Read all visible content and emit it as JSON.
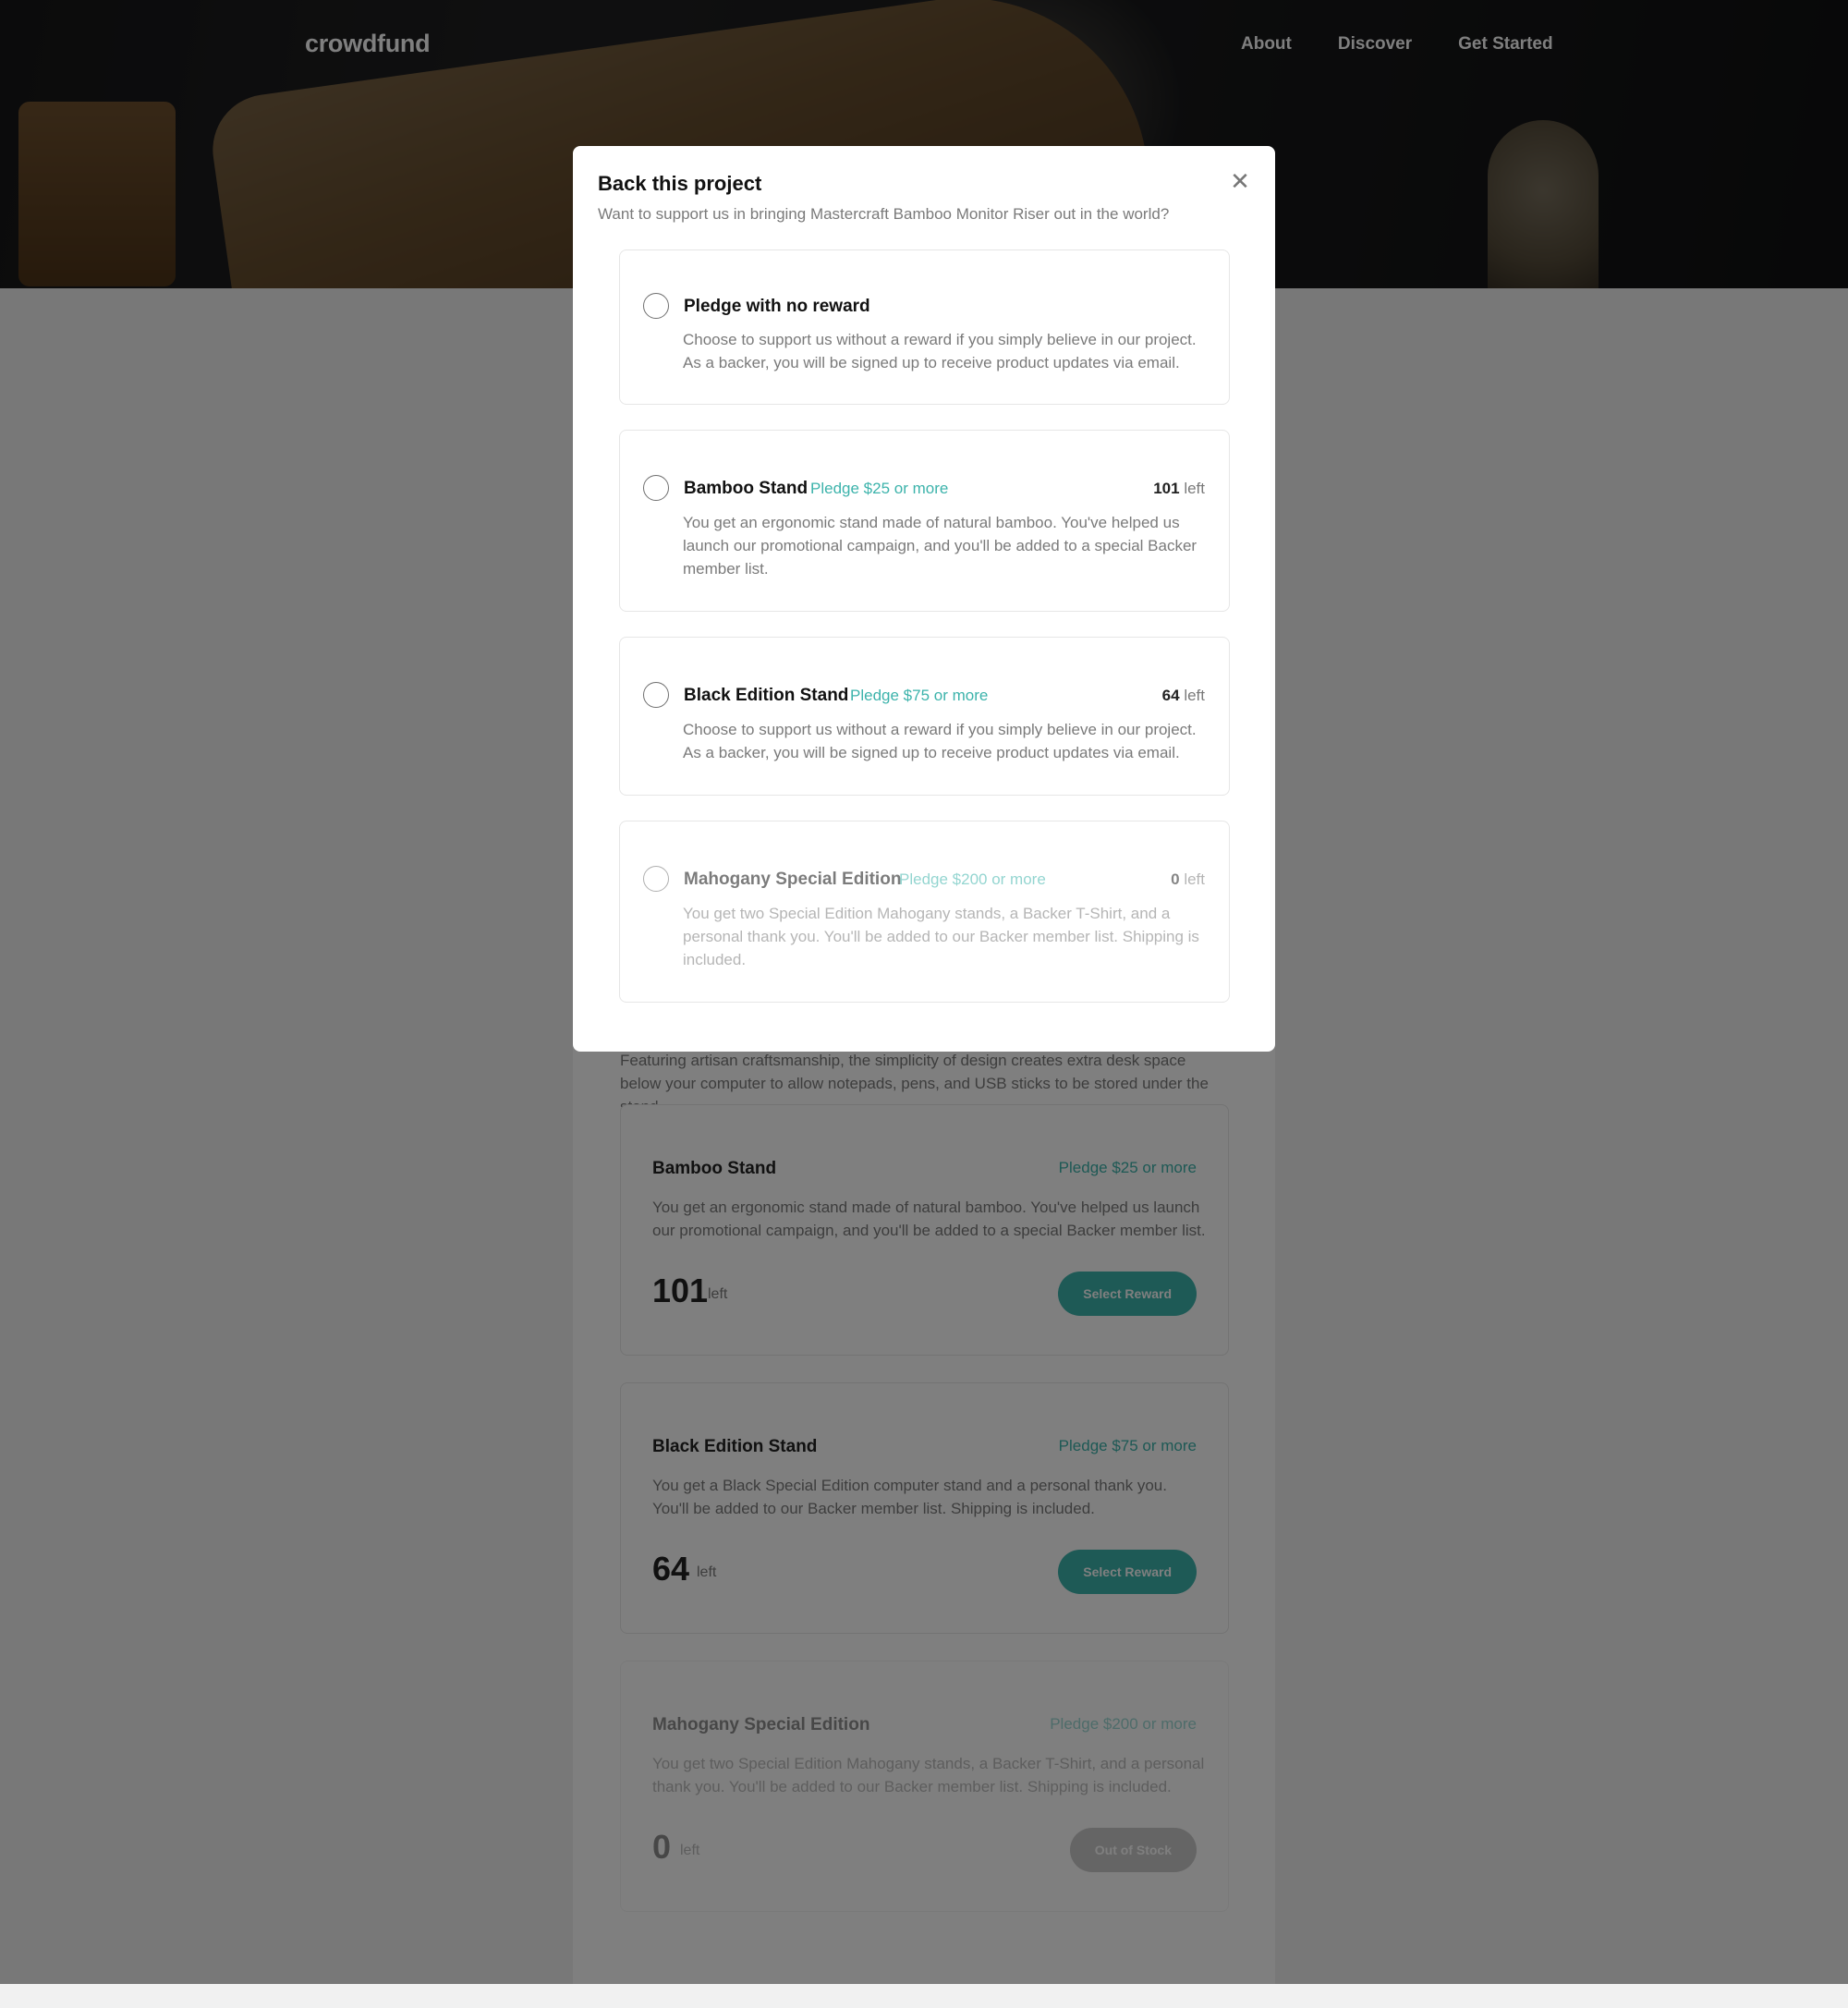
{
  "header": {
    "brand": "crowdfund",
    "nav": [
      "About",
      "Discover",
      "Get Started"
    ]
  },
  "page": {
    "about_text": "Featuring artisan craftsmanship, the simplicity of design creates extra desk space below your computer to allow notepads, pens, and USB sticks to be stored under the stand.",
    "rewards": [
      {
        "name": "Bamboo Stand",
        "pledge": "Pledge $25 or more",
        "desc": "You get an ergonomic stand made of natural bamboo. You've helped us launch our promotional campaign, and you'll be added to a special Backer member list.",
        "count": "101",
        "left": "left",
        "button": "Select Reward"
      },
      {
        "name": "Black Edition Stand",
        "pledge": "Pledge $75 or more",
        "desc": "You get a Black Special Edition computer stand and a personal thank you. You'll be added to our Backer member list. Shipping is included.",
        "count": "64",
        "left": "left",
        "button": "Select Reward"
      },
      {
        "name": "Mahogany Special Edition",
        "pledge": "Pledge $200 or more",
        "desc": "You get two Special Edition Mahogany stands, a Backer T-Shirt, and a personal thank you. You'll be added to our Backer member list. Shipping is included.",
        "count": "0",
        "left": "left",
        "button": "Out of Stock"
      }
    ]
  },
  "modal": {
    "title": "Back this project",
    "subtitle": "Want to support us in bringing Mastercraft Bamboo Monitor Riser out in the world?",
    "close_icon": "close-icon",
    "options": [
      {
        "name": "Pledge with no reward",
        "pledge": "",
        "stock_count": "",
        "stock_label": "",
        "desc": "Choose to support us without a reward if you simply believe in our project. As a backer, you will be signed up to receive product updates via email."
      },
      {
        "name": "Bamboo Stand",
        "pledge": "Pledge $25 or more",
        "stock_count": "101",
        "stock_label": "left",
        "desc": "You get an ergonomic stand made of natural bamboo. You've helped us launch our promotional campaign, and you'll be added to a special Backer member list."
      },
      {
        "name": "Black Edition Stand",
        "pledge": "Pledge $75 or more",
        "stock_count": "64",
        "stock_label": "left",
        "desc": "Choose to support us without a reward if you simply believe in our project. As a backer, you will be signed up to receive product updates via email."
      },
      {
        "name": "Mahogany Special Edition",
        "pledge": "Pledge $200 or more",
        "stock_count": "0",
        "stock_label": "left",
        "desc": "You get two Special Edition Mahogany stands, a Backer T-Shirt, and a personal thank you. You'll be added to our Backer member list. Shipping is included."
      }
    ]
  },
  "colors": {
    "accent": "#3cb4ac",
    "dark_accent": "#147b74",
    "overlay": "rgba(0,0,0,0.5)"
  }
}
